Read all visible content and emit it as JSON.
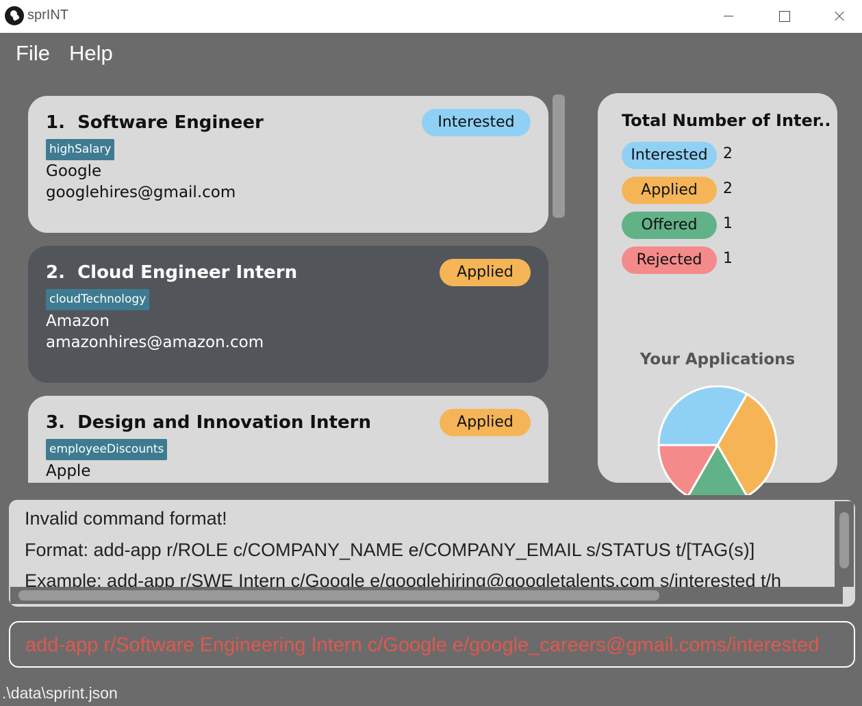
{
  "window": {
    "title": "sprINT",
    "logo_icon": "sprint-logo-icon",
    "controls": [
      "minimize-icon",
      "maximize-icon",
      "close-icon"
    ]
  },
  "menu": {
    "file": "File",
    "help": "Help"
  },
  "applications": [
    {
      "index": "1.",
      "role": "Software Engineer",
      "status": "Interested",
      "tag": "highSalary",
      "company": "Google",
      "email": "googlehires@gmail.com"
    },
    {
      "index": "2.",
      "role": "Cloud Engineer Intern",
      "status": "Applied",
      "tag": "cloudTechnology",
      "company": "Amazon",
      "email": "amazonhires@amazon.com"
    },
    {
      "index": "3.",
      "role": "Design and Innovation Intern",
      "status": "Applied",
      "tag": "employeeDiscounts",
      "company": "Apple",
      "email": ""
    }
  ],
  "stats": {
    "title": "Total Number of Inter...",
    "rows": [
      {
        "label": "Interested",
        "count": "2",
        "color": "#8fd1f5"
      },
      {
        "label": "Applied",
        "count": "2",
        "color": "#f5b557"
      },
      {
        "label": "Offered",
        "count": "1",
        "color": "#62b287"
      },
      {
        "label": "Rejected",
        "count": "1",
        "color": "#f48a8a"
      }
    ],
    "pie_title": "Your Applications"
  },
  "chart_data": {
    "type": "pie",
    "title": "Your Applications",
    "categories": [
      "Interested",
      "Applied",
      "Offered",
      "Rejected"
    ],
    "values": [
      2,
      2,
      1,
      1
    ],
    "colors": [
      "#8fd1f5",
      "#f5b557",
      "#62b287",
      "#f48a8a"
    ]
  },
  "result": {
    "lines": [
      "Invalid command format!",
      "Format: add-app r/ROLE c/COMPANY_NAME e/COMPANY_EMAIL s/STATUS t/[TAG(s)]",
      "Example: add-app r/SWE Intern c/Google e/googlehiring@googletalents.com s/interested t/h"
    ]
  },
  "command": {
    "value": "add-app r/Software Engineering Intern c/Google e/google_careers@gmail.coms/interested",
    "text_color": "#e0584f"
  },
  "status_bar": {
    "path": ".\\data\\sprint.json"
  }
}
